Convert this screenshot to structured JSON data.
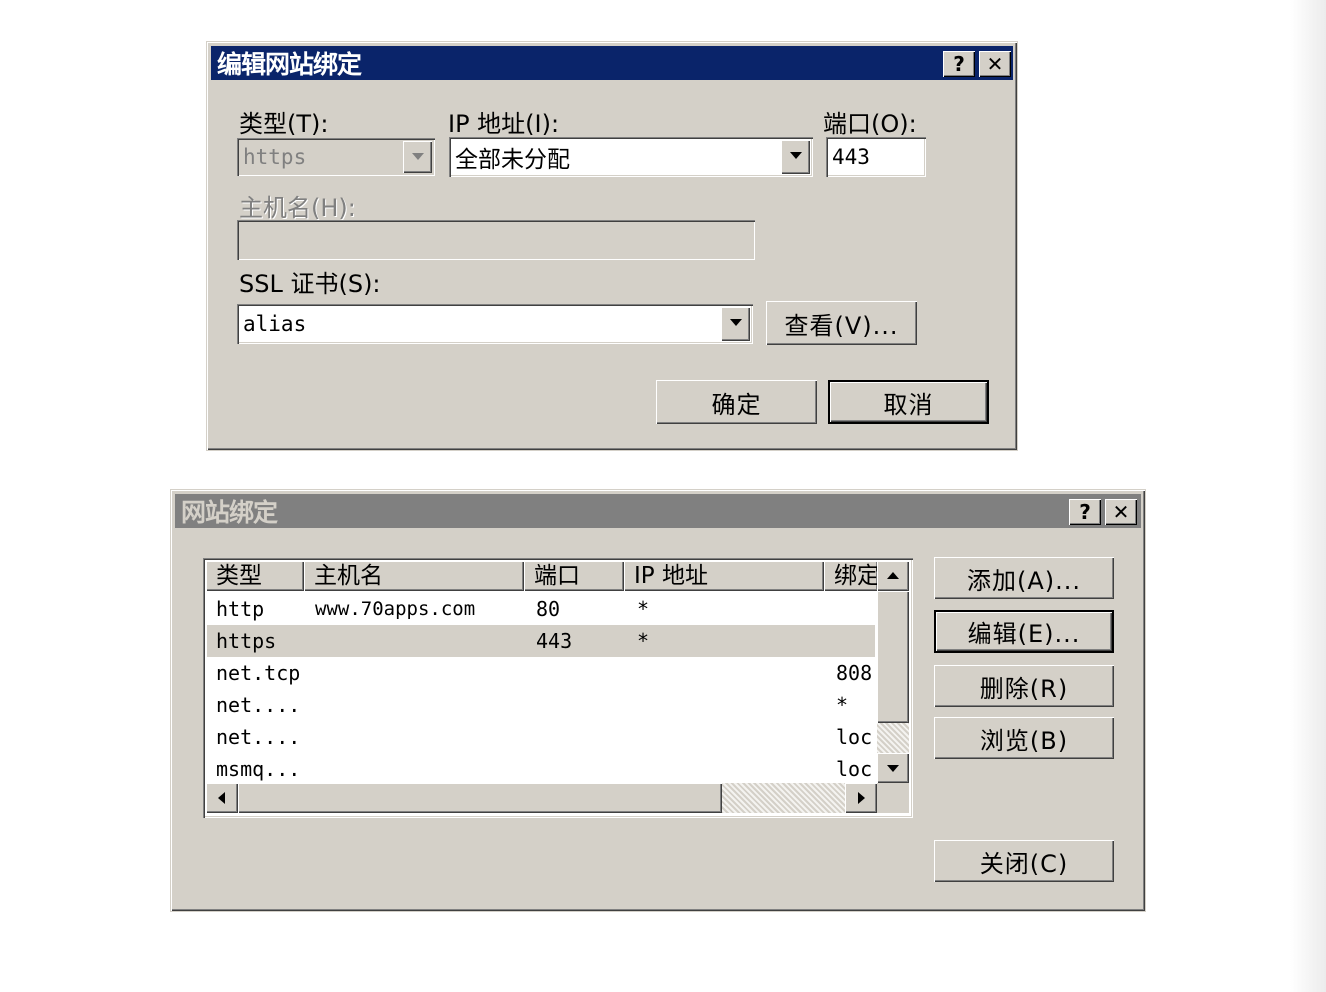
{
  "edit_dialog": {
    "title": "编辑网站绑定",
    "help_label": "?",
    "close_label": "✕",
    "type_label": "类型(T):",
    "type_value": "https",
    "ip_label": "IP 地址(I):",
    "ip_value": "全部未分配",
    "port_label": "端口(O):",
    "port_value": "443",
    "hostname_label": "主机名(H):",
    "hostname_value": "",
    "ssl_label": "SSL 证书(S):",
    "ssl_value": "alias",
    "view_label": "查看(V)...",
    "ok_label": "确定",
    "cancel_label": "取消"
  },
  "bindings_dialog": {
    "title": "网站绑定",
    "help_label": "?",
    "close_label": "✕",
    "columns": [
      "类型",
      "主机名",
      "端口",
      "IP 地址",
      "绑定"
    ],
    "rows": [
      {
        "type": "http",
        "host": "www.70apps.com",
        "port": "80",
        "ip": "*",
        "binding": ""
      },
      {
        "type": "https",
        "host": "",
        "port": "443",
        "ip": "*",
        "binding": ""
      },
      {
        "type": "net.tcp",
        "host": "",
        "port": "",
        "ip": "",
        "binding": "808"
      },
      {
        "type": "net....",
        "host": "",
        "port": "",
        "ip": "",
        "binding": "*"
      },
      {
        "type": "net....",
        "host": "",
        "port": "",
        "ip": "",
        "binding": "loc"
      },
      {
        "type": "msmq...",
        "host": "",
        "port": "",
        "ip": "",
        "binding": "loc"
      }
    ],
    "selected_row": 1,
    "add_label": "添加(A)...",
    "edit_label": "编辑(E)...",
    "remove_label": "删除(R)",
    "browse_label": "浏览(B)",
    "close_button_label": "关闭(C)"
  }
}
